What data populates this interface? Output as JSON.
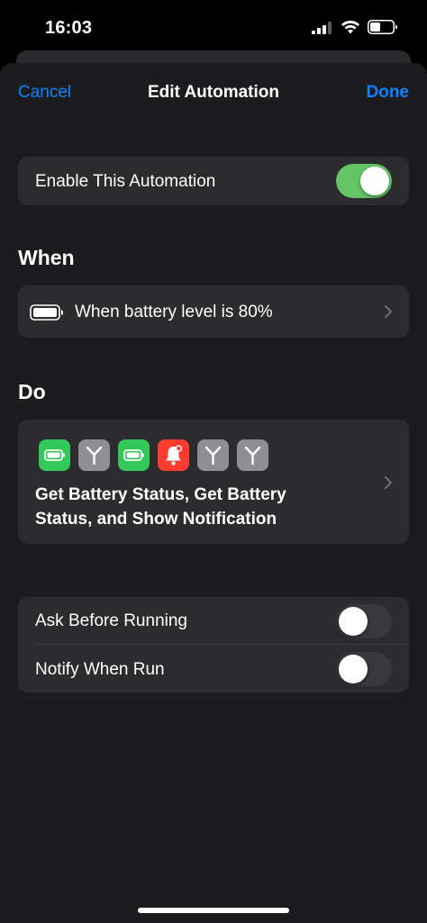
{
  "status_bar": {
    "time": "16:03",
    "icons": [
      "cellular-signal-icon",
      "wifi-icon",
      "battery-icon"
    ]
  },
  "nav": {
    "cancel_label": "Cancel",
    "title": "Edit Automation",
    "done_label": "Done"
  },
  "enable_row": {
    "label": "Enable This Automation",
    "enabled": true
  },
  "when": {
    "header": "When",
    "trigger_label": "When battery level is 80%",
    "icon": "battery-icon"
  },
  "do": {
    "header": "Do",
    "action_icons": [
      {
        "name": "battery-action-icon",
        "color": "#34c759"
      },
      {
        "name": "branch-action-icon",
        "color": "#8e8e93"
      },
      {
        "name": "battery-action-icon",
        "color": "#34c759"
      },
      {
        "name": "notification-action-icon",
        "color": "#ff3b30"
      },
      {
        "name": "branch-action-icon",
        "color": "#8e8e93"
      },
      {
        "name": "branch-action-icon",
        "color": "#8e8e93"
      }
    ],
    "summary": "Get Battery Status, Get Battery Status, and Show Notification"
  },
  "options": {
    "ask_before_running": {
      "label": "Ask Before Running",
      "enabled": false
    },
    "notify_when_run": {
      "label": "Notify When Run",
      "enabled": false
    }
  },
  "colors": {
    "accent": "#0a84ff",
    "toggle_on": "#65c466",
    "background": "#1c1c1e",
    "card": "#2c2c2e"
  }
}
